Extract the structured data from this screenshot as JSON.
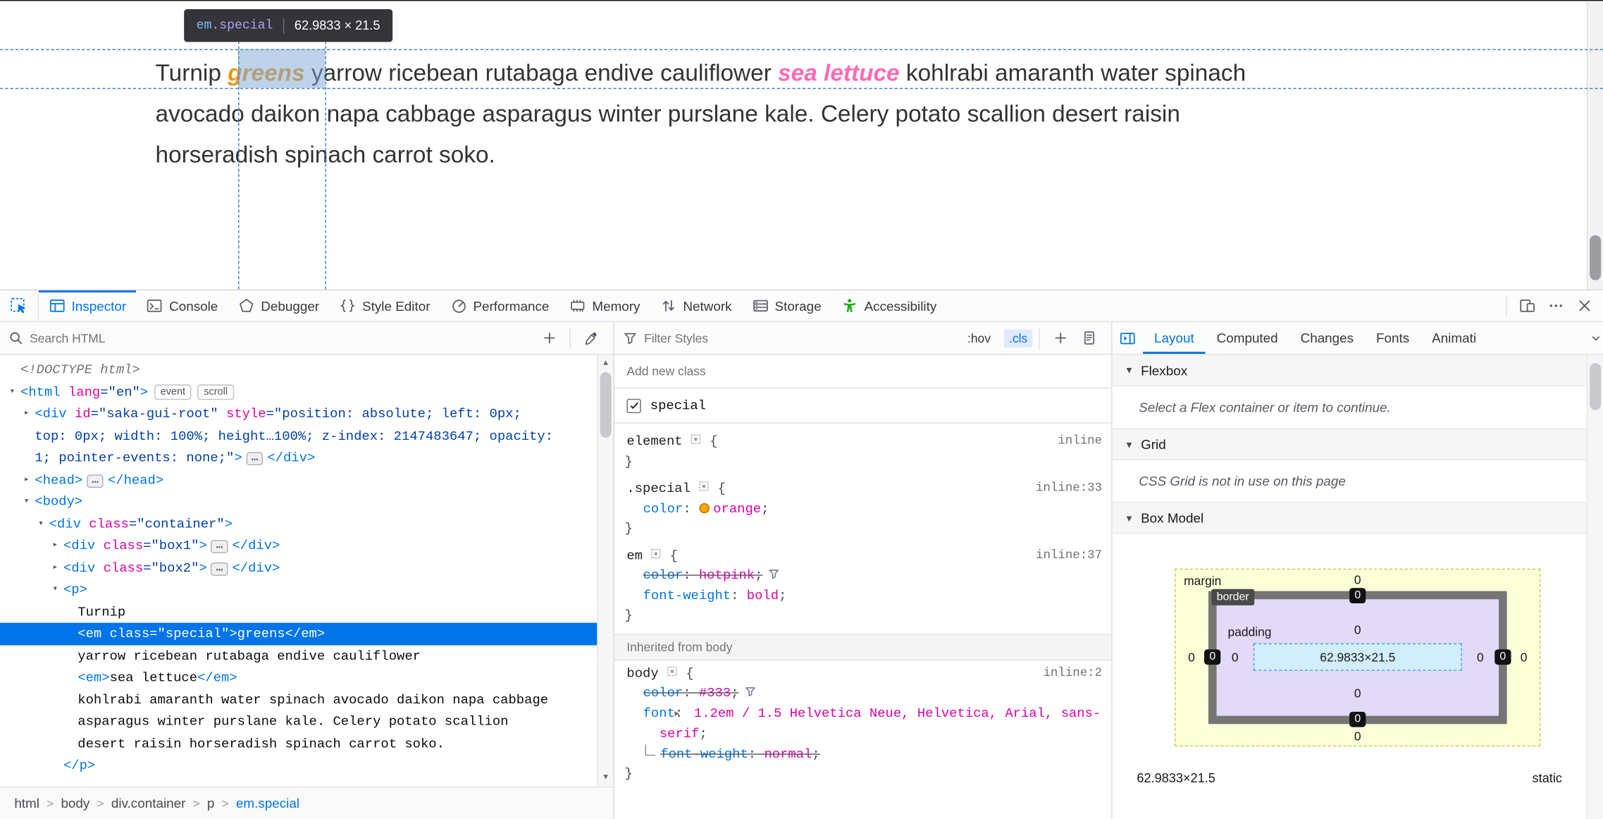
{
  "colors": {
    "accent_blue": "#0074e8",
    "attribute_magenta": "#dd00a9",
    "value_blue": "#003eaa",
    "orange_swatch": "#ffa500",
    "hotpink": "#ff69b4",
    "a11y_green": "#17af0f",
    "guide_blue": "#4083c9",
    "selection_blue": "#0074e8",
    "page_text": "#333333"
  },
  "page": {
    "infobar": {
      "tag": "em",
      "class": ".special",
      "dims": "62.9833 × 21.5"
    },
    "paragraph_lines": [
      [
        {
          "t": "plain",
          "s": "Turnip "
        },
        {
          "t": "em-special",
          "s": "greens"
        },
        {
          "t": "plain",
          "s": " yarrow ricebean rutabaga endive cauliflower "
        },
        {
          "t": "em",
          "s": "sea lettuce"
        },
        {
          "t": "plain",
          "s": " kohlrabi amaranth water spinach"
        }
      ],
      [
        {
          "t": "plain",
          "s": "avocado daikon napa cabbage asparagus winter purslane kale. Celery potato scallion desert raisin"
        }
      ],
      [
        {
          "t": "plain",
          "s": "horseradish spinach carrot soko."
        }
      ]
    ]
  },
  "devtools": {
    "toolbar": {
      "tabs": [
        {
          "label": "Inspector",
          "icon": "inspector-icon",
          "active": true
        },
        {
          "label": "Console",
          "icon": "console-icon"
        },
        {
          "label": "Debugger",
          "icon": "debugger-icon"
        },
        {
          "label": "Style Editor",
          "icon": "style-editor-icon"
        },
        {
          "label": "Performance",
          "icon": "performance-icon"
        },
        {
          "label": "Memory",
          "icon": "memory-icon"
        },
        {
          "label": "Network",
          "icon": "network-icon"
        },
        {
          "label": "Storage",
          "icon": "storage-icon"
        },
        {
          "label": "Accessibility",
          "icon": "accessibility-icon",
          "green": true
        }
      ]
    }
  },
  "markup": {
    "search_placeholder": "Search HTML",
    "lines": [
      {
        "d": 0,
        "t": [
          [
            "doc",
            "<!DOCTYPE html>"
          ]
        ]
      },
      {
        "d": 0,
        "tw": "exp",
        "t": [
          [
            "tag",
            ""
          ],
          [
            "badge",
            "event"
          ],
          [
            "badge",
            "scroll"
          ]
        ],
        "html_open": true,
        "t2": "unused"
      },
      {
        "d": 1,
        "tw": "col",
        "t": [
          [
            "tag",
            "<div"
          ],
          [
            "attr",
            " id"
          ],
          [
            "val",
            "=\"saka-gui-root\""
          ],
          [
            "attr",
            " style"
          ],
          [
            "val",
            "=\"position: absolute; left: 0px;"
          ]
        ]
      },
      {
        "d": 1,
        "t": [
          [
            "val",
            "top: 0px; width: 100%; height…100%; z-index: 2147483647; opacity:"
          ]
        ]
      },
      {
        "d": 1,
        "t": [
          [
            "val",
            "1; pointer-events: none;\""
          ],
          [
            "tag",
            ">"
          ],
          [
            "dots",
            "…"
          ],
          [
            "tag",
            "</div>"
          ]
        ]
      },
      {
        "d": 1,
        "tw": "col",
        "t": [
          [
            "tag",
            "<head>"
          ],
          [
            "dots",
            "…"
          ],
          [
            "tag",
            "</head>"
          ]
        ]
      },
      {
        "d": 1,
        "tw": "exp",
        "t": [
          [
            "tag",
            "<body>"
          ]
        ]
      },
      {
        "d": 2,
        "tw": "exp",
        "t": [
          [
            "tag",
            "<div"
          ],
          [
            "attr",
            " class"
          ],
          [
            "val",
            "=\"container\""
          ],
          [
            "tag",
            ">"
          ]
        ]
      },
      {
        "d": 3,
        "tw": "col",
        "t": [
          [
            "tag",
            "<div"
          ],
          [
            "attr",
            " class"
          ],
          [
            "val",
            "=\"box1\""
          ],
          [
            "tag",
            ">"
          ],
          [
            "dots",
            "…"
          ],
          [
            "tag",
            "</div>"
          ]
        ]
      },
      {
        "d": 3,
        "tw": "col",
        "t": [
          [
            "tag",
            "<div"
          ],
          [
            "attr",
            " class"
          ],
          [
            "val",
            "=\"box2\""
          ],
          [
            "tag",
            ">"
          ],
          [
            "dots",
            "…"
          ],
          [
            "tag",
            "</div>"
          ]
        ]
      },
      {
        "d": 3,
        "tw": "exp",
        "t": [
          [
            "tag",
            "<p>"
          ]
        ]
      },
      {
        "d": 4,
        "t": [
          [
            "txt",
            "Turnip"
          ]
        ]
      },
      {
        "d": 4,
        "sel": true,
        "t": [
          [
            "tag",
            "<em"
          ],
          [
            "attr",
            " class"
          ],
          [
            "val",
            "=\"special\""
          ],
          [
            "tag",
            ">"
          ],
          [
            "txt",
            "greens"
          ],
          [
            "tag",
            "</em>"
          ]
        ]
      },
      {
        "d": 4,
        "t": [
          [
            "txt",
            "yarrow ricebean rutabaga endive cauliflower"
          ]
        ]
      },
      {
        "d": 4,
        "t": [
          [
            "tag",
            "<em>"
          ],
          [
            "txt",
            "sea lettuce"
          ],
          [
            "tag",
            "</em>"
          ]
        ]
      },
      {
        "d": 4,
        "t": [
          [
            "txt",
            "kohlrabi amaranth water spinach avocado daikon napa cabbage"
          ]
        ]
      },
      {
        "d": 4,
        "t": [
          [
            "txt",
            "asparagus winter purslane kale. Celery potato scallion"
          ]
        ]
      },
      {
        "d": 4,
        "t": [
          [
            "txt",
            "desert raisin horseradish spinach carrot soko."
          ]
        ]
      },
      {
        "d": 3,
        "t": [
          [
            "tag",
            "</p>"
          ]
        ]
      }
    ],
    "html_line_tokens": [
      [
        "tag",
        "<html"
      ],
      [
        "attr",
        " lang"
      ],
      [
        "val",
        "=\"en\""
      ],
      [
        "tag",
        ">"
      ],
      [
        "badge",
        "event"
      ],
      [
        "badge",
        "scroll"
      ]
    ],
    "breadcrumbs": [
      {
        "label": "html"
      },
      {
        "label": "body"
      },
      {
        "label": "div.container"
      },
      {
        "label": "p"
      },
      {
        "label": "em.special",
        "active": true
      }
    ]
  },
  "rules": {
    "filter_placeholder": "Filter Styles",
    "pseudo_button": ":hov",
    "class_button": ".cls",
    "add_class_placeholder": "Add new class",
    "class_toggle": {
      "label": "special",
      "checked": true
    },
    "rules": [
      {
        "selector": "element",
        "link": "inline",
        "decls": []
      },
      {
        "selector": ".special",
        "link": "inline:33",
        "decls": [
          {
            "name": "color",
            "value": "orange",
            "swatch": "#ffa500"
          }
        ]
      },
      {
        "selector": "em",
        "link": "inline:37",
        "decls": [
          {
            "name": "color",
            "value": "hotpink",
            "overridden": true,
            "filter": true
          },
          {
            "name": "font-weight",
            "value": "bold"
          }
        ]
      }
    ],
    "inherited_header": "Inherited from body",
    "inherited_rules": [
      {
        "selector": "body",
        "link": "inline:2",
        "decls": [
          {
            "name": "color",
            "value": "#333",
            "overridden": true,
            "filter": true
          },
          {
            "name": "font",
            "value": "1.2em / 1.5 Helvetica Neue, Helvetica, Arial, sans-serif",
            "expander": true
          },
          {
            "name": "font-weight",
            "value": "normal",
            "overridden": true,
            "sub": true
          }
        ]
      }
    ]
  },
  "layout_panel": {
    "tabs": [
      {
        "label": "Layout",
        "active": true
      },
      {
        "label": "Computed"
      },
      {
        "label": "Changes"
      },
      {
        "label": "Fonts"
      },
      {
        "label": "Animati"
      }
    ],
    "flexbox": {
      "title": "Flexbox",
      "message": "Select a Flex container or item to continue."
    },
    "grid": {
      "title": "Grid",
      "message": "CSS Grid is not in use on this page"
    },
    "box_model": {
      "title": "Box Model",
      "labels": {
        "margin": "margin",
        "border": "border",
        "padding": "padding"
      },
      "margin": {
        "top": "0",
        "right": "0",
        "bottom": "0",
        "left": "0"
      },
      "border": {
        "top": "0",
        "right": "0",
        "bottom": "0",
        "left": "0"
      },
      "padding": {
        "top": "0",
        "right": "0",
        "bottom": "0",
        "left": "0"
      },
      "content": "62.9833×21.5",
      "footer_dims": "62.9833×21.5",
      "footer_position": "static"
    }
  }
}
